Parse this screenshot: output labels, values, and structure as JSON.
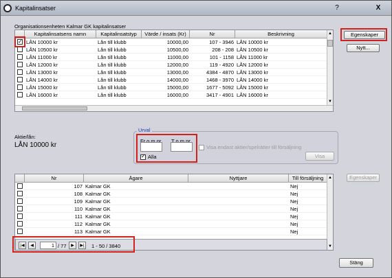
{
  "window": {
    "title": "Kapitalinsatser",
    "help_label": "?",
    "close_label": "X"
  },
  "top": {
    "section_label": "Organisationsenheten Kalmar GK kapitalinsatser",
    "columns": [
      "Kapitalinsatsens namn",
      "Kapitalinsatstyp",
      "Värde / insats (Kr)",
      "Nr",
      "Beskrivning"
    ],
    "rows": [
      {
        "checked": true,
        "name": "LÅN 10000 kr",
        "type": "Lån till klubb",
        "value": "10000,00",
        "nr": "107 - 3946",
        "desc": "LÅN 10000 kr"
      },
      {
        "checked": false,
        "name": "LÅN 10500 kr",
        "type": "Lån till klubb",
        "value": "10500,00",
        "nr": "208 - 208",
        "desc": "LÅN 10500 kr"
      },
      {
        "checked": false,
        "name": "LÅN 11000 kr",
        "type": "Lån till klubb",
        "value": "11000,00",
        "nr": "101 - 1158",
        "desc": "LÅN 11000 kr"
      },
      {
        "checked": false,
        "name": "LÅN 12000 kr",
        "type": "Lån till klubb",
        "value": "12000,00",
        "nr": "119 - 4920",
        "desc": "LÅN 12000 kr"
      },
      {
        "checked": false,
        "name": "LÅN 13000 kr",
        "type": "Lån till klubb",
        "value": "13000,00",
        "nr": "4384 - 4870",
        "desc": "LÅN 13000 kr"
      },
      {
        "checked": false,
        "name": "LÅN 14000 kr",
        "type": "Lån till klubb",
        "value": "14000,00",
        "nr": "1468 - 3970",
        "desc": "LÅN 14000 kr"
      },
      {
        "checked": false,
        "name": "LÅN 15000 kr",
        "type": "Lån till klubb",
        "value": "15000,00",
        "nr": "1677 - 5092",
        "desc": "LÅN 15000 kr"
      },
      {
        "checked": false,
        "name": "LÅN 16000 kr",
        "type": "Lån till klubb",
        "value": "16000,00",
        "nr": "3417 - 4901",
        "desc": "LÅN 16000 kr"
      }
    ],
    "buttons": {
      "properties": "Egenskaper",
      "new": "Nytt..."
    }
  },
  "selection": {
    "label": "Aktie/lån:",
    "value": "LÅN 10000 kr"
  },
  "filter": {
    "legend": "Urval",
    "from_label": "Fr o m nr",
    "to_label": "T o m nr",
    "from_value": "",
    "to_value": "",
    "all_label": "Alla",
    "all_checked": true,
    "for_sale_label": "Visa endast aktier/spelrätter till försäljning",
    "for_sale_checked": false,
    "show_button": "Visa"
  },
  "bottom": {
    "columns": [
      "Nr",
      "Ägare",
      "Nyttjare",
      "Till försäljning"
    ],
    "rows": [
      {
        "nr": "107",
        "owner": "Kalmar GK",
        "user": "",
        "sale": "Nej"
      },
      {
        "nr": "108",
        "owner": "Kalmar GK",
        "user": "",
        "sale": "Nej"
      },
      {
        "nr": "109",
        "owner": "Kalmar GK",
        "user": "",
        "sale": "Nej"
      },
      {
        "nr": "110",
        "owner": "Kalmar GK",
        "user": "",
        "sale": "Nej"
      },
      {
        "nr": "111",
        "owner": "Kalmar GK",
        "user": "",
        "sale": "Nej"
      },
      {
        "nr": "112",
        "owner": "Kalmar GK",
        "user": "",
        "sale": "Nej"
      },
      {
        "nr": "113",
        "owner": "Kalmar GK",
        "user": "",
        "sale": "Nej"
      }
    ],
    "properties_button": "Egenskaper"
  },
  "pager": {
    "page": "1",
    "total": "/ 77",
    "range": "1 - 50 / 3840"
  },
  "close_button": "Stäng",
  "colors": {
    "highlight": "#d2201c",
    "legend_blue": "#1a3ea8"
  }
}
